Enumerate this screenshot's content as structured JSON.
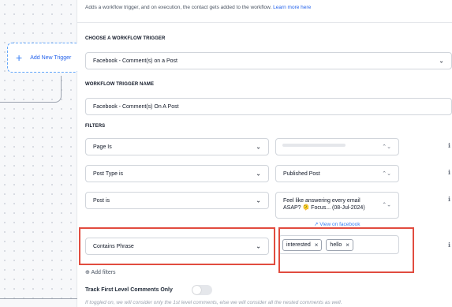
{
  "header": {
    "description": "Adds a workflow trigger, and on execution, the contact gets added to the workflow.",
    "learn_more": "Learn more here"
  },
  "canvas": {
    "add_trigger_label": "Add New Trigger"
  },
  "form": {
    "choose_trigger_label": "CHOOSE A WORKFLOW TRIGGER",
    "trigger_value": "Facebook - Comment(s) on a Post",
    "trigger_name_label": "WORKFLOW TRIGGER NAME",
    "trigger_name_value": "Facebook - Comment(s) On A Post",
    "filters_label": "FILTERS",
    "filters": [
      {
        "field": "Page Is",
        "value": ""
      },
      {
        "field": "Post Type is",
        "value": "Published Post"
      },
      {
        "field": "Post is",
        "value_line1": "Feel like answering every email",
        "value_line2": "ASAP? 🫠 Focus... (08-Jul-2024)"
      },
      {
        "field": "Contains Phrase",
        "chips": [
          "interested",
          "hello"
        ]
      }
    ],
    "view_on_facebook": "View on facebook",
    "add_filters": "Add filters",
    "track_first_level": "Track First Level Comments Only",
    "track_help": "If toggled on, we will consider only the 1st level comments, else we will consider all the nested comments as well.",
    "track_toggle_on": false
  },
  "icons": {
    "plus": "+",
    "chevron_down": "⌄",
    "updown": "⌃⌄",
    "info": "ℹ",
    "close": "×",
    "add_circle": "⊕",
    "external_link": "↗"
  },
  "colors": {
    "accent": "#2563eb",
    "highlight": "#e14c3f"
  }
}
